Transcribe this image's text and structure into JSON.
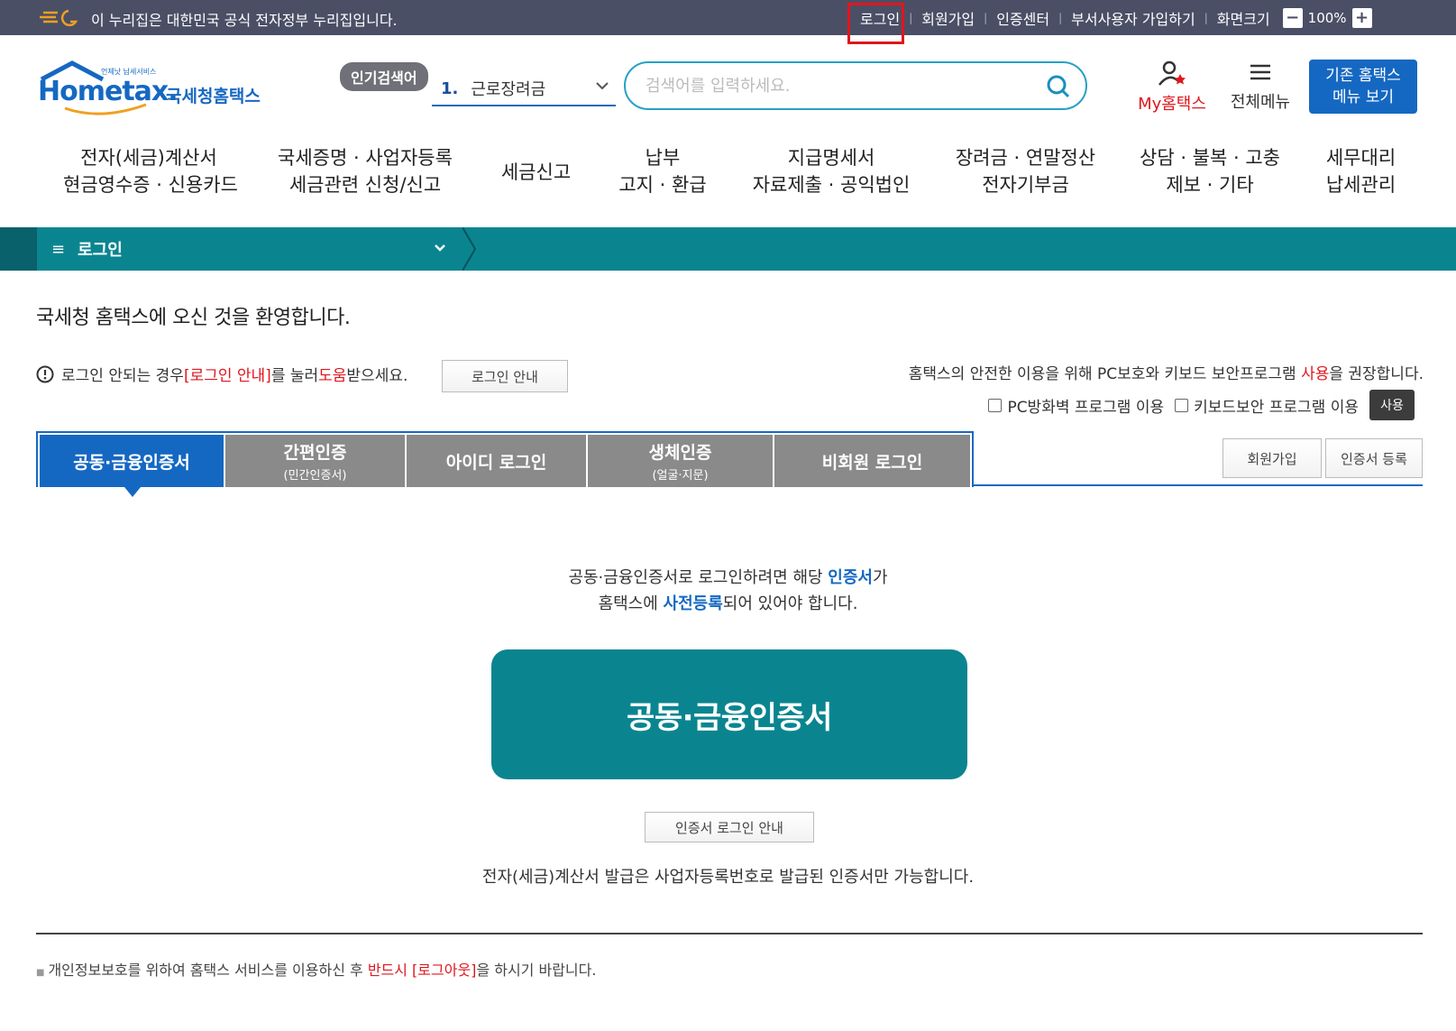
{
  "gov_bar": {
    "notice": "이 누리집은 대한민국 공식 전자정부 누리집입니다.",
    "links": [
      "로그인",
      "회원가입",
      "인증센터",
      "부서사용자 가입하기",
      "화면크기"
    ],
    "zoom_minus": "−",
    "zoom_value": "100%",
    "zoom_plus": "+"
  },
  "header": {
    "logo_text": "Hometax.",
    "logo_sub": "국세청홈택스",
    "logo_tag": "언제낫 납세서비스",
    "popular_badge": "인기검색어",
    "popular_num": "1.",
    "popular_term": "근로장려금",
    "search_placeholder": "검색어를 입력하세요.",
    "my_label": "My홈택스",
    "allmenu_label": "전체메뉴",
    "old_menu_line1": "기존 홈택스",
    "old_menu_line2": "메뉴 보기"
  },
  "main_nav": [
    {
      "line1": "전자(세금)계산서",
      "line2": "현금영수증 · 신용카드"
    },
    {
      "line1": "국세증명 · 사업자등록",
      "line2": "세금관련 신청/신고"
    },
    {
      "line1": "세금신고",
      "line2": ""
    },
    {
      "line1": "납부",
      "line2": "고지 · 환급"
    },
    {
      "line1": "지급명세서",
      "line2": "자료제출 · 공익법인"
    },
    {
      "line1": "장려금 · 연말정산",
      "line2": "전자기부금"
    },
    {
      "line1": "상담 · 불복 · 고충",
      "line2": "제보 · 기타"
    },
    {
      "line1": "세무대리",
      "line2": "납세관리"
    }
  ],
  "breadcrumb": {
    "label": "로그인"
  },
  "welcome": "국세청 홈택스에 오신 것을 환영합니다.",
  "notice": {
    "part1": "로그인 안되는 경우 ",
    "link1": "[로그인 안내]",
    "part2": "를 눌러 ",
    "link2": "도움",
    "part3": "받으세요.",
    "button": "로그인 안내"
  },
  "security": {
    "part1": "홈택스의 안전한 이용을 위해 PC보호와 키보드 보안프로그램 ",
    "highlight": "사용",
    "part2": "을 권장합니다.",
    "check1": "PC방화벽 프로그램 이용",
    "check2": "키보드보안 프로그램 이용",
    "use_button": "사용"
  },
  "tabs": [
    {
      "label": "공동·금융인증서",
      "sub": ""
    },
    {
      "label": "간편인증",
      "sub": "(민간인증서)"
    },
    {
      "label": "아이디 로그인",
      "sub": ""
    },
    {
      "label": "생체인증",
      "sub": "(얼굴·지문)"
    },
    {
      "label": "비회원 로그인",
      "sub": ""
    }
  ],
  "right_buttons": {
    "signup": "회원가입",
    "register_cert": "인증서 등록"
  },
  "cert": {
    "desc1a": "공동·금융인증서로 로그인하려면 해당 ",
    "desc1b": "인증서",
    "desc1c": "가",
    "desc2a": "홈택스에 ",
    "desc2b": "사전등록",
    "desc2c": "되어 있어야 합니다.",
    "big_button": "공동·금융인증서",
    "guide_button": "인증서 로그인 안내",
    "issue_note": "전자(세금)계산서 발급은 사업자등록번호로 발급된 인증서만 가능합니다."
  },
  "footer": {
    "part1": "개인정보보호를 위하여 홈택스 서비스를 이용하신 후 ",
    "red": "반드시 [로그아웃]",
    "part2": "을 하시기 바랍니다."
  },
  "colors": {
    "teal": "#0a8590",
    "blue": "#1568c2",
    "red": "#e0161d",
    "govbar": "#4a4f66"
  }
}
